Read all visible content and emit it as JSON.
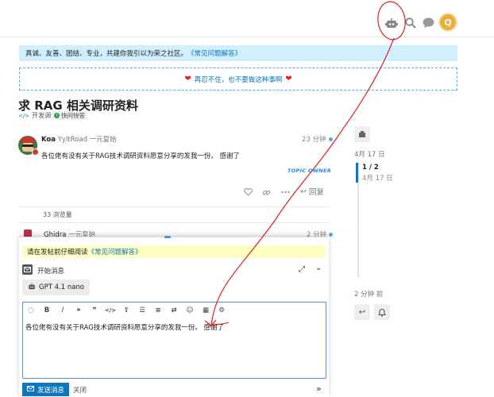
{
  "header": {
    "icons": [
      "robot-icon",
      "search-icon",
      "chat-bubble-icon"
    ],
    "avatar_letter": "Q"
  },
  "banner": {
    "text": "真诚、友善、团结、专业，共建你我引以为荣之社区。",
    "link": "《常见问题解答》"
  },
  "notice": {
    "text": "再忍不住，也不要做这种事啊"
  },
  "topic": {
    "title": "求 RAG 相关调研资料",
    "category": "开发调优",
    "tag": "快问快答"
  },
  "post1": {
    "username": "Koa",
    "fullname": "YyltRoad",
    "title": "一元复始",
    "time": "23 分钟",
    "body": "各位佬有没有关于RAG技术调研资料愿意分享的发我一份。 感谢了",
    "owner_badge": "TOPIC OWNER",
    "reply_label": "回复"
  },
  "views": "33 浏览量",
  "post2": {
    "username": "Ghidra",
    "title": "一元复始",
    "time": "2 分钟"
  },
  "timeline": {
    "start_date": "4月 17 日",
    "position": "1 / 2",
    "position_date": "4月 17 日",
    "last_ago": "2 分钟 前"
  },
  "composer": {
    "notice_text": "请在发帖前仔细阅读",
    "notice_link": "《常见问题解答》",
    "mode_label": "开始消息",
    "model": "GPT 4.1 nano",
    "editor_text": "各位佬有没有关于RAG技术调研资料愿意分享的发我一份。 感谢了",
    "send_label": "发送消息",
    "close_label": "关闭"
  },
  "colors": {
    "accent": "#0e76bd",
    "banner_bg": "#d1f0ff",
    "notice_bg": "#ffffc4",
    "annotation": "#e02020"
  }
}
